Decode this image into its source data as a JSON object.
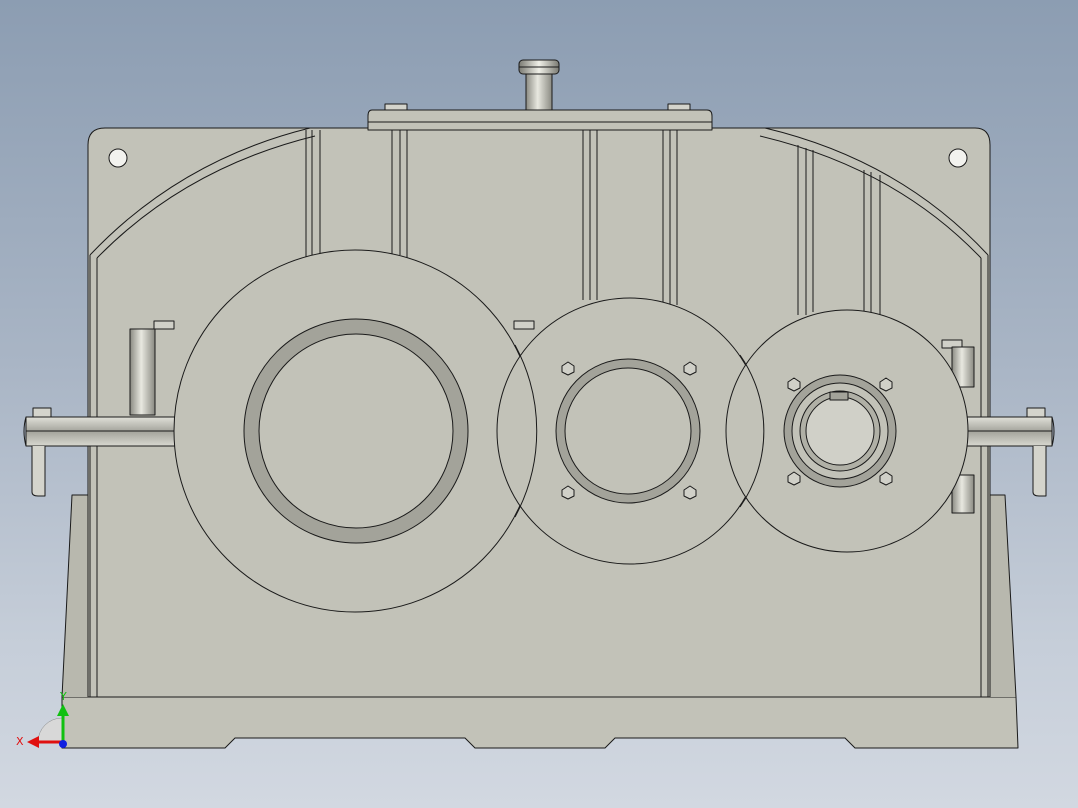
{
  "viewport": {
    "background_top": "#8c9db2",
    "background_bottom": "#d2d8e1"
  },
  "model": {
    "body_color": "#c2c2b8",
    "edge_color": "#1a1a1a",
    "bore_ring_color": "#9e9e94"
  },
  "triad": {
    "x_label": "X",
    "y_label": "Y",
    "x_color": "#e01010",
    "y_color": "#10c010",
    "z_color": "#1020e0"
  }
}
